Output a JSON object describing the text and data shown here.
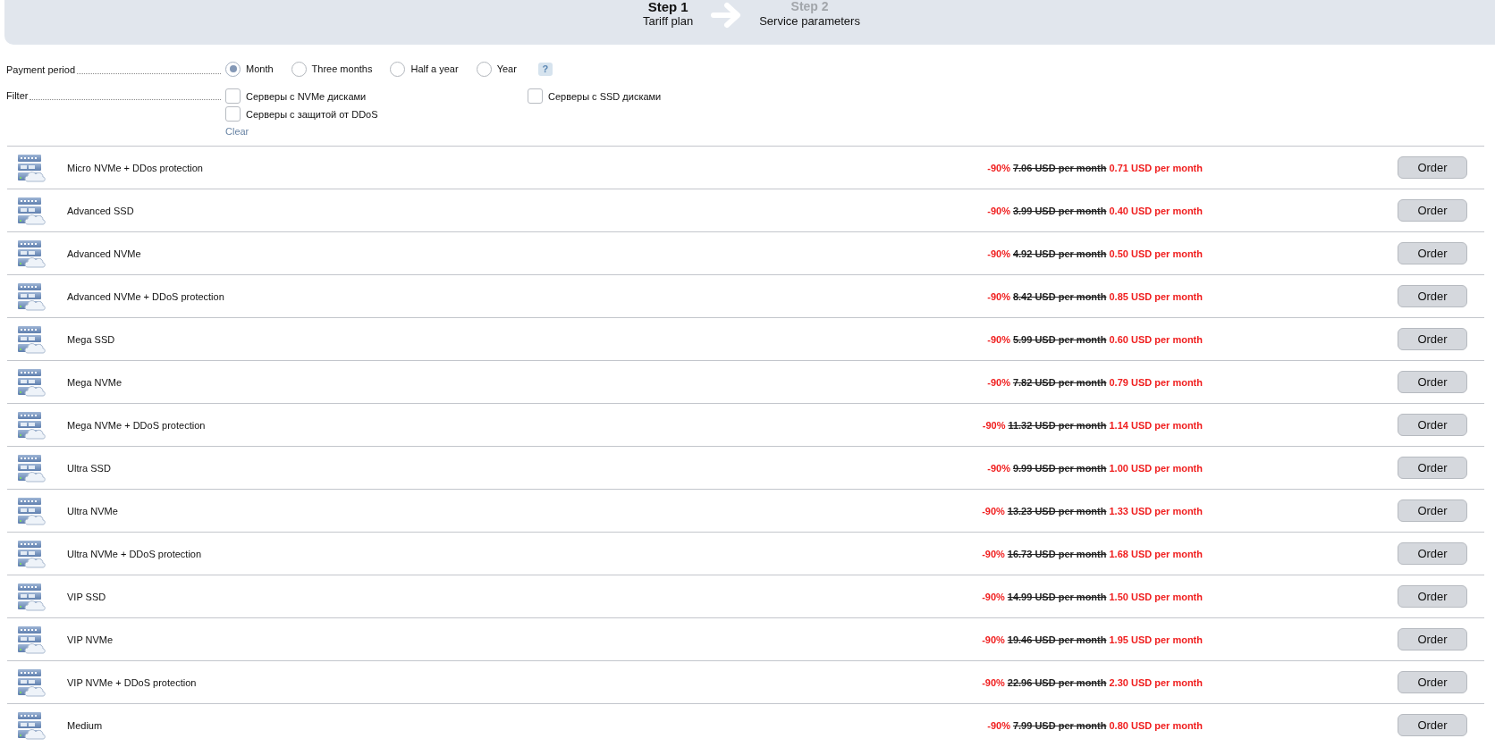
{
  "header": {
    "steps": [
      {
        "label": "Step 1",
        "caption": "Tariff plan",
        "selected": true
      },
      {
        "label": "Step 2",
        "caption": "Service parameters",
        "selected": false
      }
    ]
  },
  "payment_period": {
    "label": "Payment period",
    "options": [
      {
        "label": "Month",
        "selected": true
      },
      {
        "label": "Three months",
        "selected": false
      },
      {
        "label": "Half a year",
        "selected": false
      },
      {
        "label": "Year",
        "selected": false
      }
    ],
    "help": "?"
  },
  "filter": {
    "label": "Filter",
    "options": [
      {
        "label": "Серверы с NVMe дисками",
        "checked": false
      },
      {
        "label": "Серверы с SSD дисками",
        "checked": false
      },
      {
        "label": "Серверы с защитой от DDoS",
        "checked": false
      }
    ],
    "clear": "Clear"
  },
  "plans": [
    {
      "name": "Micro NVMe + DDos protection",
      "discount": "-90%",
      "old_price": "7.06 USD per month",
      "price": "0.71 USD per month",
      "button": "Order"
    },
    {
      "name": "Advanced SSD",
      "discount": "-90%",
      "old_price": "3.99 USD per month",
      "price": "0.40 USD per month",
      "button": "Order"
    },
    {
      "name": "Advanced NVMe",
      "discount": "-90%",
      "old_price": "4.92 USD per month",
      "price": "0.50 USD per month",
      "button": "Order"
    },
    {
      "name": "Advanced NVMe + DDoS protection",
      "discount": "-90%",
      "old_price": "8.42 USD per month",
      "price": "0.85 USD per month",
      "button": "Order"
    },
    {
      "name": "Mega SSD",
      "discount": "-90%",
      "old_price": "5.99 USD per month",
      "price": "0.60 USD per month",
      "button": "Order"
    },
    {
      "name": "Mega NVMe",
      "discount": "-90%",
      "old_price": "7.82 USD per month",
      "price": "0.79 USD per month",
      "button": "Order"
    },
    {
      "name": "Mega NVMe + DDoS protection",
      "discount": "-90%",
      "old_price": "11.32 USD per month",
      "price": "1.14 USD per month",
      "button": "Order"
    },
    {
      "name": "Ultra SSD",
      "discount": "-90%",
      "old_price": "9.99 USD per month",
      "price": "1.00 USD per month",
      "button": "Order"
    },
    {
      "name": "Ultra NVMe",
      "discount": "-90%",
      "old_price": "13.23 USD per month",
      "price": "1.33 USD per month",
      "button": "Order"
    },
    {
      "name": "Ultra NVMe + DDoS protection",
      "discount": "-90%",
      "old_price": "16.73 USD per month",
      "price": "1.68 USD per month",
      "button": "Order"
    },
    {
      "name": "VIP SSD",
      "discount": "-90%",
      "old_price": "14.99 USD per month",
      "price": "1.50 USD per month",
      "button": "Order"
    },
    {
      "name": "VIP NVMe",
      "discount": "-90%",
      "old_price": "19.46 USD per month",
      "price": "1.95 USD per month",
      "button": "Order"
    },
    {
      "name": "VIP NVMe + DDoS protection",
      "discount": "-90%",
      "old_price": "22.96 USD per month",
      "price": "2.30 USD per month",
      "button": "Order"
    },
    {
      "name": "Medium",
      "discount": "-90%",
      "old_price": "7.99 USD per month",
      "price": "0.80 USD per month",
      "button": "Order"
    }
  ]
}
